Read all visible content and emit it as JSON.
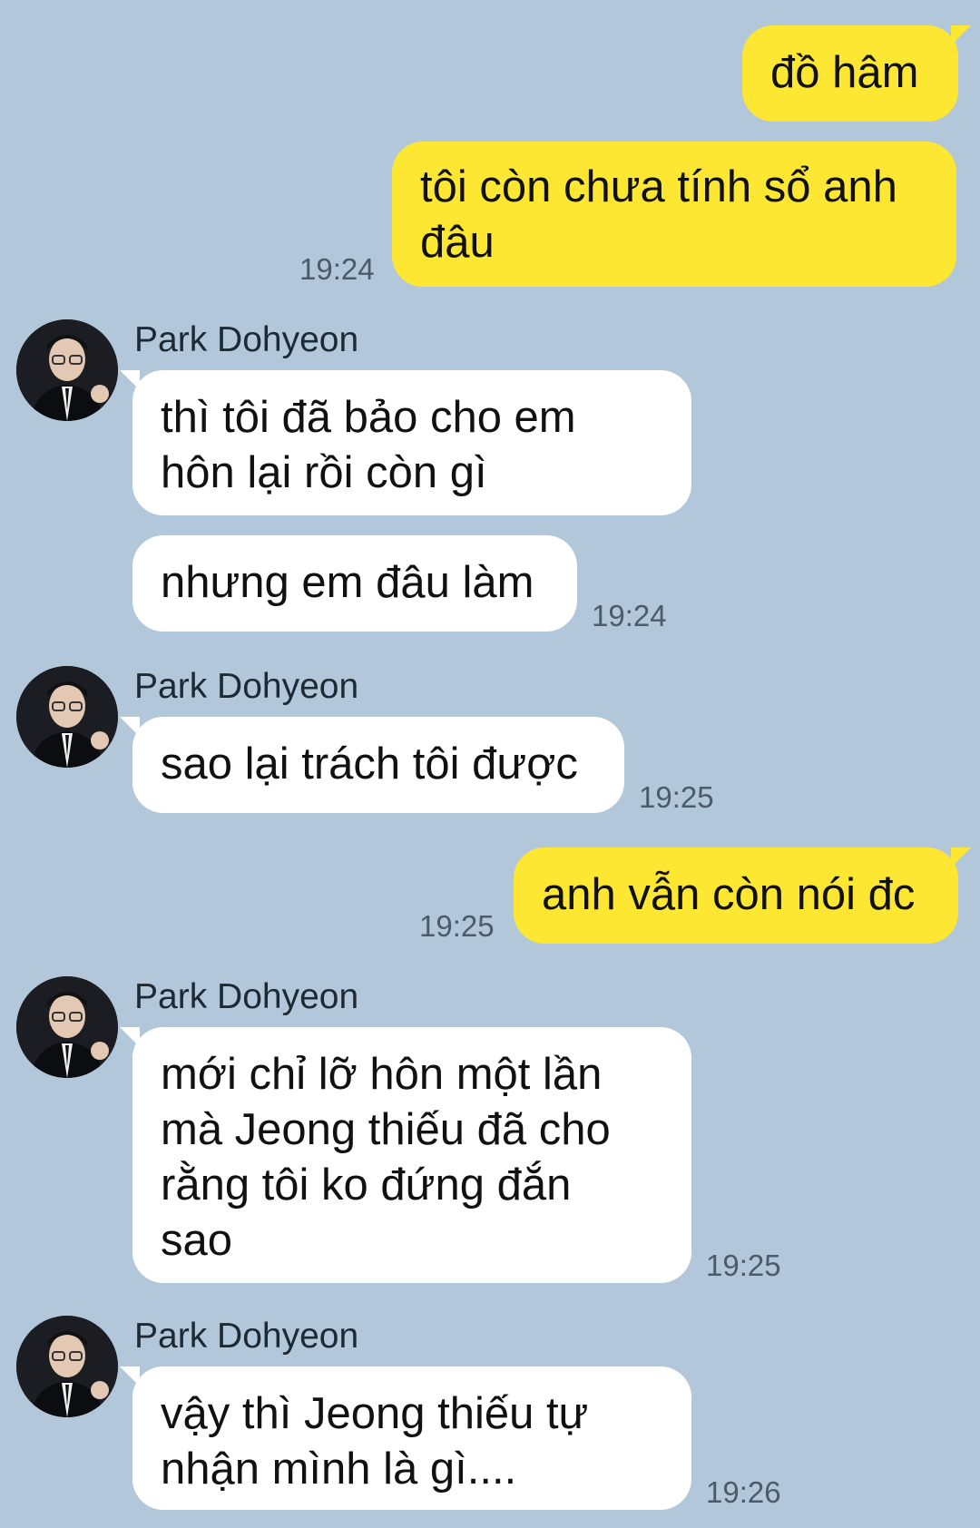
{
  "contact": {
    "name": "Park Dohyeon"
  },
  "messages": [
    {
      "id": "m1",
      "direction": "out",
      "text": "đồ hâm",
      "time": ""
    },
    {
      "id": "m2",
      "direction": "out",
      "text": "tôi còn chưa tính sổ anh\nđâu",
      "time": "19:24"
    },
    {
      "id": "m3",
      "direction": "in",
      "sender": "Park Dohyeon",
      "text": "thì tôi đã bảo cho em\nhôn lại rồi còn gì",
      "time": ""
    },
    {
      "id": "m4",
      "direction": "in",
      "text": "nhưng em đâu làm",
      "time": "19:24"
    },
    {
      "id": "m5",
      "direction": "in",
      "sender": "Park Dohyeon",
      "text": "sao lại trách tôi được",
      "time": "19:25"
    },
    {
      "id": "m6",
      "direction": "out",
      "text": "anh vẫn còn nói đc",
      "time": "19:25"
    },
    {
      "id": "m7",
      "direction": "in",
      "sender": "Park Dohyeon",
      "text": "mới chỉ lỡ hôn một lần\nmà Jeong thiếu đã cho\nrằng tôi ko đứng đắn\nsao",
      "time": "19:25"
    },
    {
      "id": "m8",
      "direction": "in",
      "sender": "Park Dohyeon",
      "text": "vậy thì Jeong thiếu tự\nnhận mình là gì....",
      "time": "19:26"
    }
  ],
  "colors": {
    "background": "#b2c7da",
    "outgoing_bubble": "#fde732",
    "incoming_bubble": "#ffffff",
    "timestamp": "#4d5b69"
  },
  "icons": {
    "avatar": "profile-photo-avatar-icon"
  }
}
